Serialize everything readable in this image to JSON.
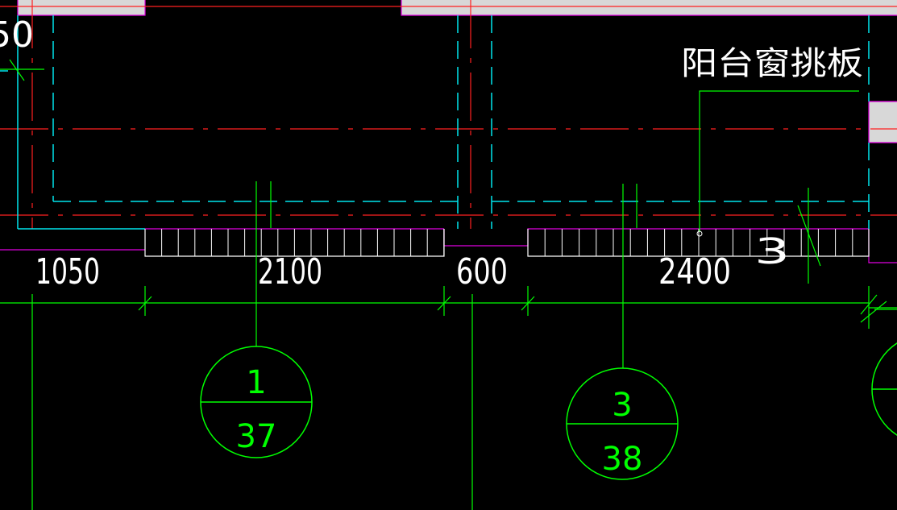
{
  "drawing": {
    "background": "#000000",
    "annotation_label": "阳台窗挑板",
    "left_edge_fragment": "50",
    "dimensions": [
      "1050",
      "2100",
      "600",
      "2400"
    ],
    "section_text": "3",
    "detail_markers": [
      {
        "top": "1",
        "bottom": "37"
      },
      {
        "top": "3",
        "bottom": "38"
      }
    ],
    "colors": {
      "axis_line": "#ff2020",
      "wall_line": "#00e5ee",
      "dimension_line": "#00ff00",
      "window_line": "#e000e0",
      "text": "#ffffff",
      "fill": "#d8d8d8"
    }
  }
}
